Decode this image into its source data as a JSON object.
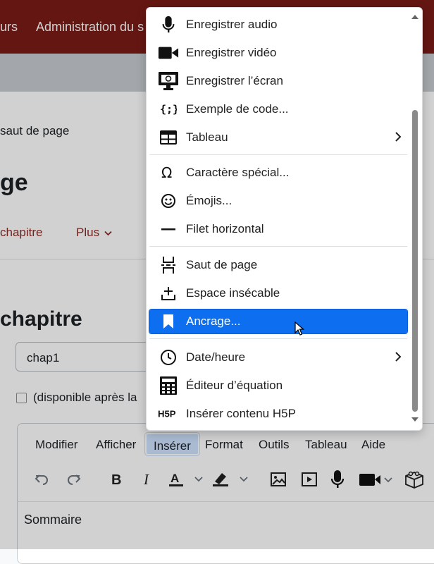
{
  "header": {
    "nav_left": "urs",
    "nav_admin": "Administration du s"
  },
  "page": {
    "breadcrumb": "saut de page",
    "title": "ge",
    "tab_chapter": "chapitre",
    "tab_more": "Plus",
    "section_title": "chapitre",
    "field_value": "chap1",
    "checkbox_label": "(disponible après la"
  },
  "editor": {
    "menubar": [
      "Modifier",
      "Afficher",
      "Insérer",
      "Format",
      "Outils",
      "Tableau",
      "Aide"
    ],
    "active_menu": "Insérer",
    "body_text": "Sommaire",
    "toolbar_icons": [
      "undo-icon",
      "redo-icon",
      "bold-icon",
      "italic-icon",
      "text-color-icon",
      "highlight-icon",
      "image-icon",
      "media-icon",
      "microphone-icon",
      "video-camera-icon",
      "h5p-box-icon"
    ]
  },
  "insert_menu": {
    "items": [
      {
        "label": "Enregistrer audio",
        "icon": "microphone-icon"
      },
      {
        "label": "Enregistrer vidéo",
        "icon": "video-camera-icon"
      },
      {
        "label": "Enregistrer l’écran",
        "icon": "screen-record-icon"
      },
      {
        "label": "Exemple de code...",
        "icon": "code-braces-icon"
      },
      {
        "label": "Tableau",
        "icon": "table-icon",
        "submenu": true
      },
      {
        "label": "Caractère spécial...",
        "icon": "omega-icon"
      },
      {
        "label": "Émojis...",
        "icon": "smiley-icon"
      },
      {
        "label": "Filet horizontal",
        "icon": "horizontal-rule-icon"
      },
      {
        "label": "Saut de page",
        "icon": "page-break-icon"
      },
      {
        "label": "Espace insécable",
        "icon": "nonbreaking-space-icon"
      },
      {
        "label": "Ancrage...",
        "icon": "bookmark-icon",
        "highlighted": true
      },
      {
        "label": "Date/heure",
        "icon": "clock-icon",
        "submenu": true
      },
      {
        "label": "Éditeur d’équation",
        "icon": "calculator-icon"
      },
      {
        "label": "Insérer contenu H5P",
        "icon": "h5p-icon"
      }
    ]
  },
  "colors": {
    "header_bg": "#7a1b17",
    "link": "#8b2b25",
    "highlight": "#0d6ff0",
    "active_menu_bg": "#cfe3ff"
  }
}
